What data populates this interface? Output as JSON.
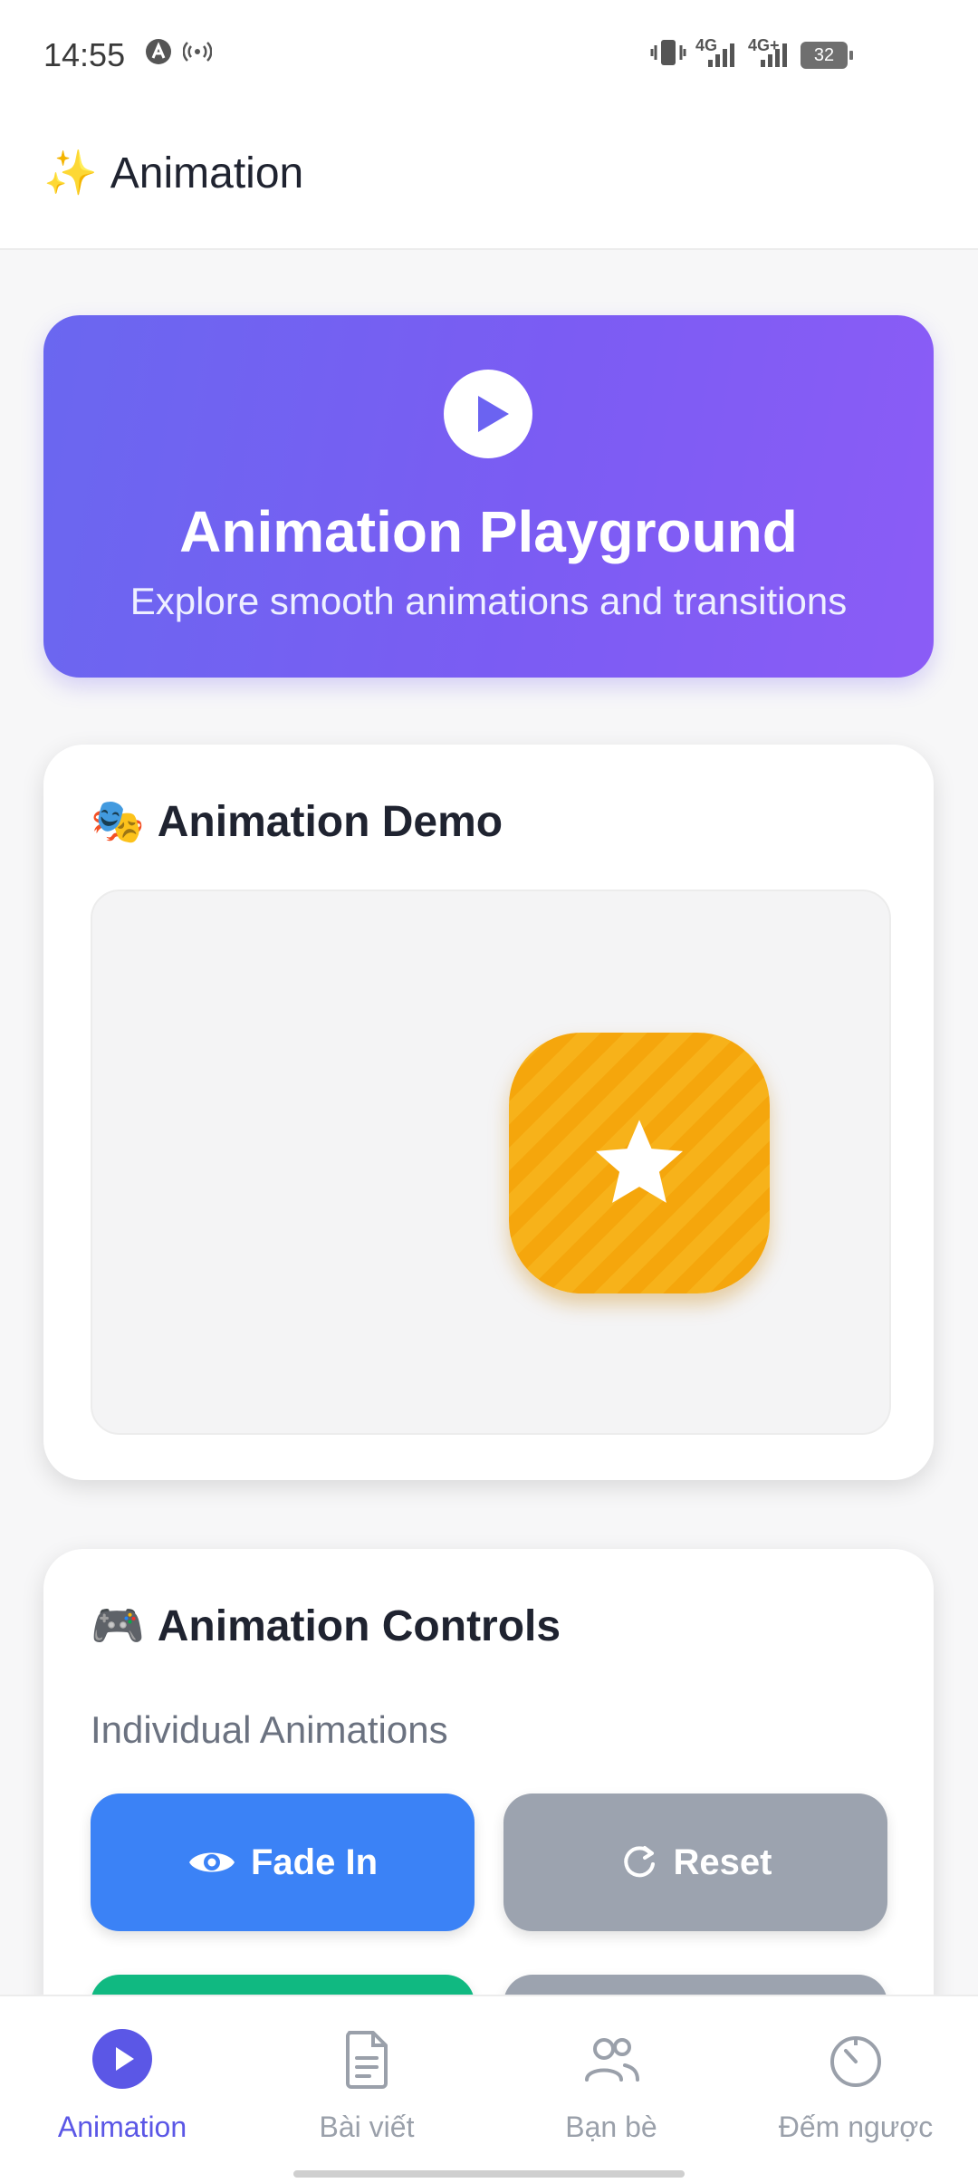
{
  "status_bar": {
    "time": "14:55",
    "signal1": "4G",
    "signal2": "4G+",
    "battery": "32"
  },
  "appbar": {
    "emoji": "✨",
    "title": "Animation"
  },
  "hero": {
    "title": "Animation Playground",
    "subtitle": "Explore smooth animations and transitions"
  },
  "demo_card": {
    "emoji": "🎭",
    "title": "Animation Demo"
  },
  "controls_card": {
    "emoji": "🎮",
    "title": "Animation Controls",
    "section_label": "Individual Animations",
    "buttons": [
      {
        "label": "Fade In",
        "icon": "eye-icon",
        "color": "#3b82f6"
      },
      {
        "label": "Reset",
        "icon": "refresh-icon",
        "color": "#9ca3af"
      }
    ]
  },
  "colors": {
    "accent": "#5b57e6",
    "hero_gradient_start": "#6a67f0",
    "hero_gradient_end": "#8b5cf6",
    "star_tile": "#f5a60c",
    "green_button": "#10b981"
  },
  "bottom_nav": {
    "items": [
      {
        "label": "Animation",
        "icon": "play-circle-icon",
        "active": true
      },
      {
        "label": "Bài viết",
        "icon": "document-icon",
        "active": false
      },
      {
        "label": "Bạn bè",
        "icon": "friends-icon",
        "active": false
      },
      {
        "label": "Đếm ngược",
        "icon": "timer-icon",
        "active": false
      }
    ]
  }
}
